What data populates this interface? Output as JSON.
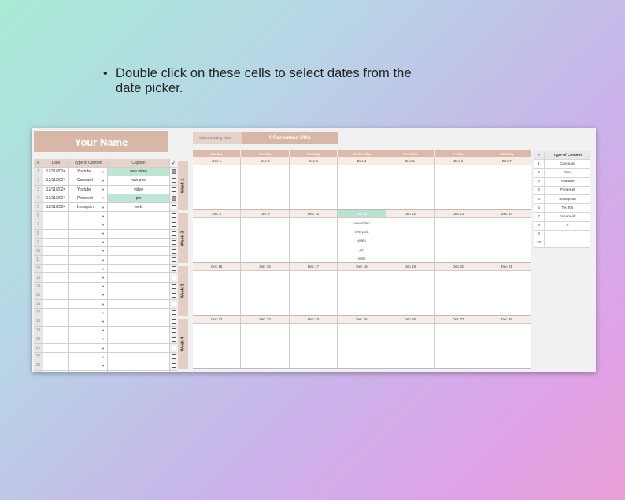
{
  "annotation": {
    "text": "Double click on these cells to select dates from the date picker."
  },
  "sheet": {
    "title": "Your Name",
    "start_label": "Select Starting Date",
    "start_value": "1 December 2024"
  },
  "left_table": {
    "headers": {
      "num": "#",
      "date": "Date",
      "type": "Type of Content",
      "caption": "Caption",
      "check": "✓"
    },
    "rows": [
      {
        "num": "1",
        "date": "12/11/2024",
        "type": "Youtube",
        "caption": "new video",
        "checked": true,
        "highlight": true
      },
      {
        "num": "2",
        "date": "12/11/2024",
        "type": "Carousel",
        "caption": "new post",
        "checked": false,
        "highlight": false
      },
      {
        "num": "3",
        "date": "12/11/2024",
        "type": "Youtube",
        "caption": "video",
        "checked": false,
        "highlight": false
      },
      {
        "num": "4",
        "date": "12/11/2024",
        "type": "Pinterest",
        "caption": "pin",
        "checked": true,
        "highlight": true
      },
      {
        "num": "5",
        "date": "12/11/2024",
        "type": "Instagram",
        "caption": "reels",
        "checked": false,
        "highlight": false
      },
      {
        "num": "6",
        "date": "",
        "type": "",
        "caption": "",
        "checked": false,
        "highlight": false
      },
      {
        "num": "7",
        "date": "",
        "type": "",
        "caption": "",
        "checked": false,
        "highlight": false
      },
      {
        "num": "8",
        "date": "",
        "type": "",
        "caption": "",
        "checked": false,
        "highlight": false
      },
      {
        "num": "9",
        "date": "",
        "type": "",
        "caption": "",
        "checked": false,
        "highlight": false
      },
      {
        "num": "10",
        "date": "",
        "type": "",
        "caption": "",
        "checked": false,
        "highlight": false
      },
      {
        "num": "11",
        "date": "",
        "type": "",
        "caption": "",
        "checked": false,
        "highlight": false
      },
      {
        "num": "12",
        "date": "",
        "type": "",
        "caption": "",
        "checked": false,
        "highlight": false
      },
      {
        "num": "13",
        "date": "",
        "type": "",
        "caption": "",
        "checked": false,
        "highlight": false
      },
      {
        "num": "14",
        "date": "",
        "type": "",
        "caption": "",
        "checked": false,
        "highlight": false
      },
      {
        "num": "15",
        "date": "",
        "type": "",
        "caption": "",
        "checked": false,
        "highlight": false
      },
      {
        "num": "16",
        "date": "",
        "type": "",
        "caption": "",
        "checked": false,
        "highlight": false
      },
      {
        "num": "17",
        "date": "",
        "type": "",
        "caption": "",
        "checked": false,
        "highlight": false
      },
      {
        "num": "18",
        "date": "",
        "type": "",
        "caption": "",
        "checked": false,
        "highlight": false
      },
      {
        "num": "19",
        "date": "",
        "type": "",
        "caption": "",
        "checked": false,
        "highlight": false
      },
      {
        "num": "20",
        "date": "",
        "type": "",
        "caption": "",
        "checked": false,
        "highlight": false
      },
      {
        "num": "21",
        "date": "",
        "type": "",
        "caption": "",
        "checked": false,
        "highlight": false
      },
      {
        "num": "22",
        "date": "",
        "type": "",
        "caption": "",
        "checked": false,
        "highlight": false
      },
      {
        "num": "23",
        "date": "",
        "type": "",
        "caption": "",
        "checked": false,
        "highlight": false
      },
      {
        "num": "24",
        "date": "",
        "type": "",
        "caption": "",
        "checked": false,
        "highlight": false
      }
    ]
  },
  "weeks_labels": [
    "Week 1",
    "Week 2",
    "Week 3",
    "Week 4"
  ],
  "calendar": {
    "days_of_week": [
      "Sunday",
      "Monday",
      "Tuesday",
      "Wednesday",
      "Thursday",
      "Friday",
      "Saturday"
    ],
    "weeks": [
      {
        "dates": [
          "Dec 1",
          "Dec 2",
          "Dec 3",
          "Dec 4",
          "Dec 5",
          "Dec 6",
          "Dec 7"
        ],
        "today_index": -1,
        "events": [
          [],
          [],
          [],
          [],
          [],
          [],
          []
        ]
      },
      {
        "dates": [
          "Dec 8",
          "Dec 9",
          "Dec 10",
          "Dec 11",
          "Dec 12",
          "Dec 13",
          "Dec 14"
        ],
        "today_index": 3,
        "events": [
          [],
          [],
          [],
          [
            "new video",
            "new post",
            "video",
            "pin",
            "reels"
          ],
          [],
          [],
          []
        ]
      },
      {
        "dates": [
          "Dec 15",
          "Dec 16",
          "Dec 17",
          "Dec 18",
          "Dec 19",
          "Dec 20",
          "Dec 21"
        ],
        "today_index": -1,
        "events": [
          [],
          [],
          [],
          [],
          [],
          [],
          []
        ]
      },
      {
        "dates": [
          "Dec 22",
          "Dec 23",
          "Dec 24",
          "Dec 25",
          "Dec 26",
          "Dec 27",
          "Dec 28"
        ],
        "today_index": -1,
        "events": [
          [],
          [],
          [],
          [],
          [],
          [],
          []
        ]
      }
    ]
  },
  "type_table": {
    "headers": {
      "num": "#",
      "type": "Type of Content"
    },
    "rows": [
      {
        "num": "1",
        "type": "Carousel"
      },
      {
        "num": "2",
        "type": "Reel"
      },
      {
        "num": "3",
        "type": "Youtube"
      },
      {
        "num": "4",
        "type": "Pinterest"
      },
      {
        "num": "5",
        "type": "Instagram"
      },
      {
        "num": "6",
        "type": "Tik Tok"
      },
      {
        "num": "7",
        "type": "Facebook"
      },
      {
        "num": "8",
        "type": "X"
      },
      {
        "num": "9",
        "type": ""
      },
      {
        "num": "10",
        "type": ""
      }
    ]
  }
}
